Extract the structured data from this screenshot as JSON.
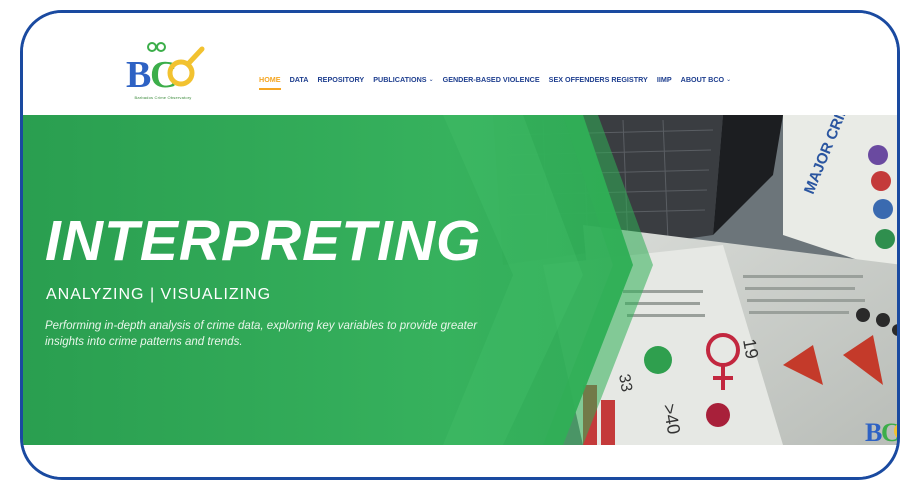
{
  "logo": {
    "letters": "BCO",
    "tagline": "Barbados Crime Observatory",
    "colors": {
      "blue": "#2e62c4",
      "green": "#3cae4a",
      "yellow": "#f2c230"
    }
  },
  "nav": {
    "items": [
      {
        "label": "HOME",
        "active": true,
        "dropdown": false
      },
      {
        "label": "DATA",
        "active": false,
        "dropdown": false
      },
      {
        "label": "REPOSITORY",
        "active": false,
        "dropdown": false
      },
      {
        "label": "PUBLICATIONS",
        "active": false,
        "dropdown": true
      },
      {
        "label": "GENDER-BASED VIOLENCE",
        "active": false,
        "dropdown": false
      },
      {
        "label": "SEX OFFENDERS REGISTRY",
        "active": false,
        "dropdown": false
      },
      {
        "label": "IIMP",
        "active": false,
        "dropdown": false
      },
      {
        "label": "ABOUT BCO",
        "active": false,
        "dropdown": true
      }
    ],
    "colors": {
      "link": "#1f3f8f",
      "active": "#f5a623"
    }
  },
  "hero": {
    "title": "INTERPRETING",
    "subtitle": "ANALYZING | VISUALIZING",
    "description": "Performing in-depth analysis of crime data, exploring key variables to provide greater insights into crime patterns and trends.",
    "poster_heading": "MAJOR CRIMES",
    "colors": {
      "green": "#2fae56",
      "frame": "#1a4aa0"
    }
  }
}
